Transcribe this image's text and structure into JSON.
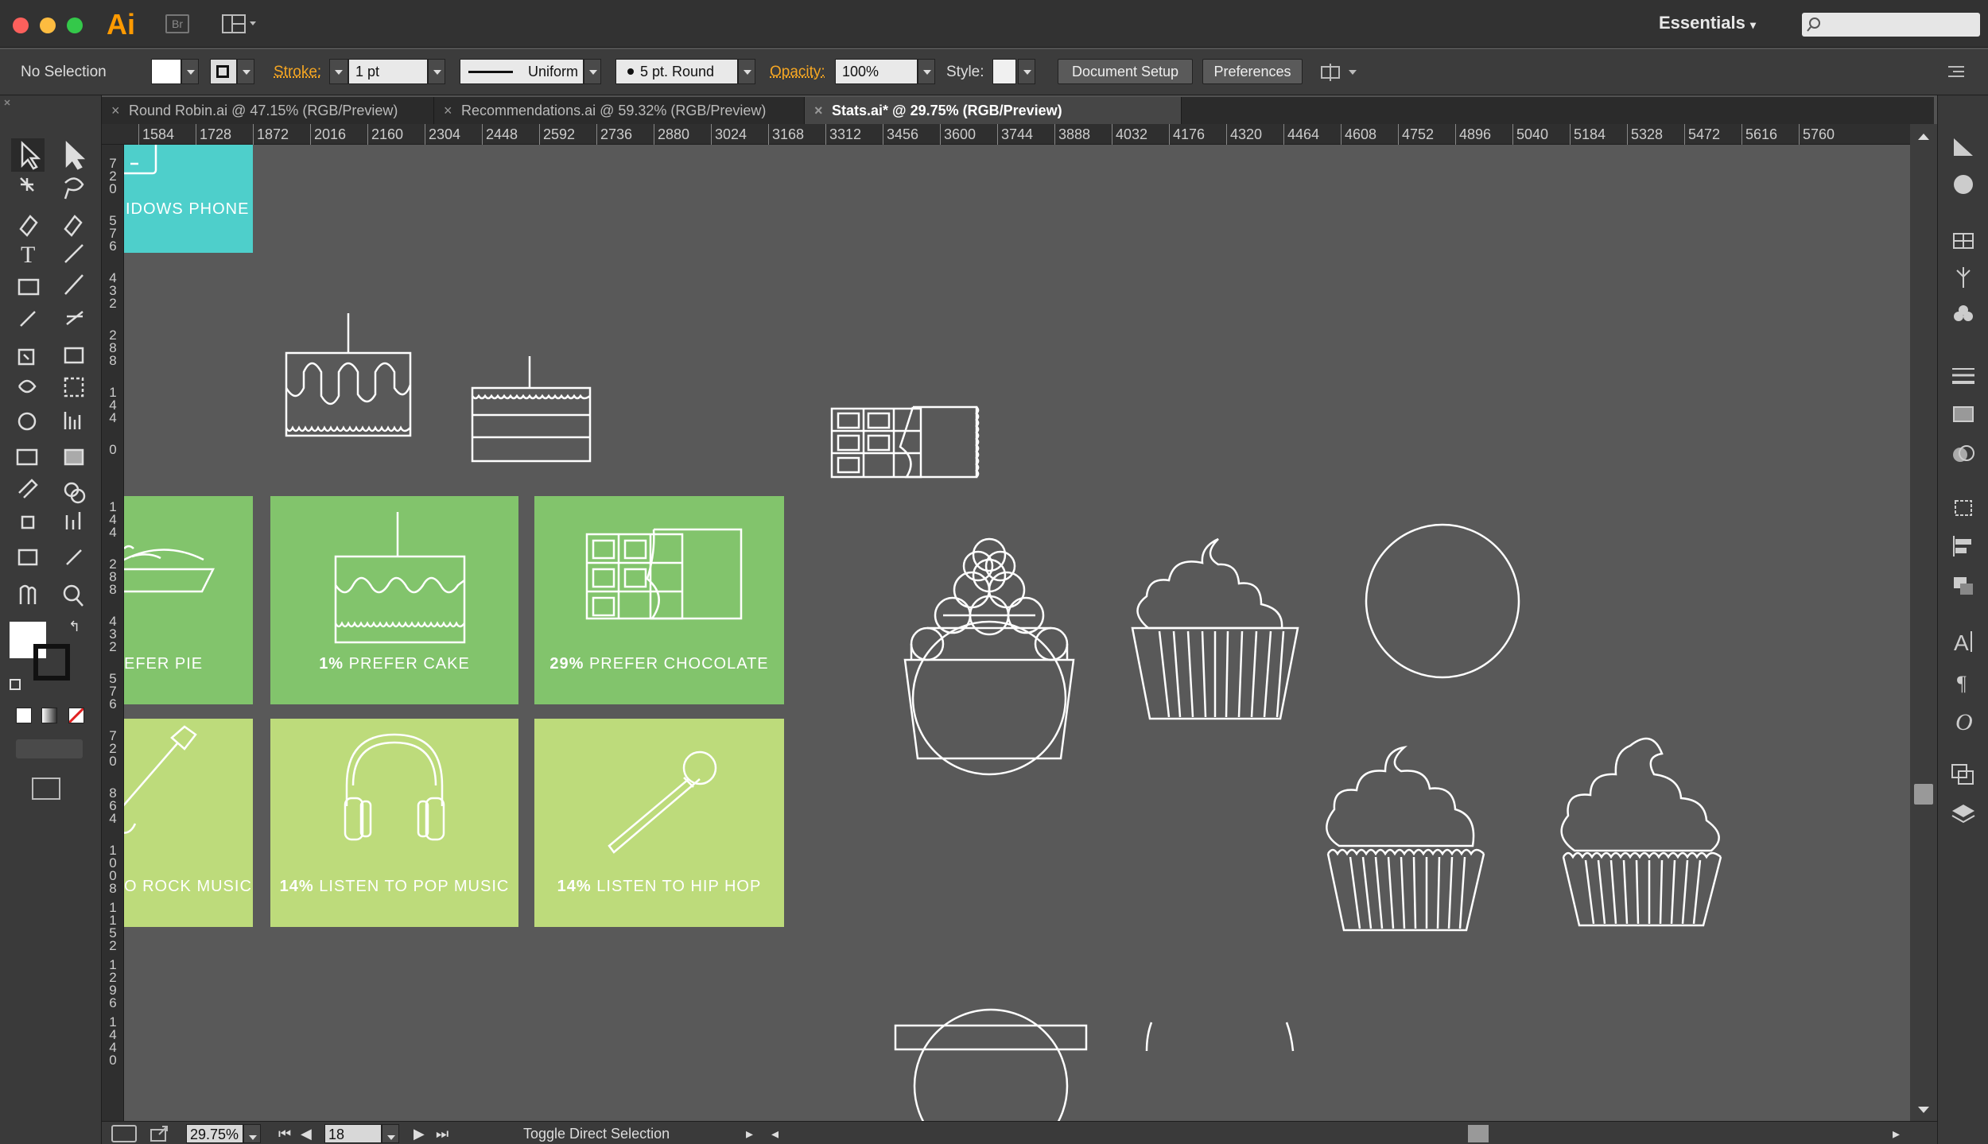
{
  "app": {
    "logo": "Ai",
    "bridge_logo": "Br",
    "workspace": "Essentials"
  },
  "control": {
    "selection": "No Selection",
    "stroke_label": "Stroke:",
    "stroke_weight": "1 pt",
    "profile": "Uniform",
    "brush": "5 pt. Round",
    "opacity_label": "Opacity:",
    "opacity_value": "100%",
    "style_label": "Style:",
    "document_setup": "Document Setup",
    "preferences": "Preferences"
  },
  "tabs": [
    {
      "label": "Round Robin.ai @ 47.15% (RGB/Preview)"
    },
    {
      "label": "Recommendations.ai @ 59.32% (RGB/Preview)"
    },
    {
      "label": "Stats.ai* @ 29.75% (RGB/Preview)",
      "active": true
    }
  ],
  "ruler": {
    "h_ticks": [
      "1584",
      "1728",
      "1872",
      "2016",
      "2160",
      "2304",
      "2448",
      "2592",
      "2736",
      "2880",
      "3024",
      "3168",
      "3312",
      "3456",
      "3600",
      "3744",
      "3888",
      "4032",
      "4176",
      "4320",
      "4464",
      "4608",
      "4752",
      "4896",
      "5040",
      "5184",
      "5328",
      "5472",
      "5616",
      "5760"
    ],
    "v_ticks": [
      "7\n2\n0",
      "5\n7\n6",
      "4\n3\n2",
      "2\n8\n8",
      "1\n4\n4",
      "0",
      "1\n4\n4",
      "2\n8\n8",
      "4\n3\n2",
      "5\n7\n6",
      "7\n2\n0",
      "8\n6\n4",
      "1\n0\n0\n8",
      "1\n1\n5\n2",
      "1\n2\n9\n6",
      "1\n4\n4\n0"
    ]
  },
  "tiles": {
    "windows_phone": {
      "text": "IDOWS PHONE",
      "color": "#4ecfcb"
    },
    "pie": {
      "text": "EFER PIE"
    },
    "cake": {
      "pct": "1%",
      "text": " PREFER CAKE"
    },
    "chocolate": {
      "pct": "29%",
      "text": " PREFER CHOCOLATE"
    },
    "rock": {
      "text": "O ROCK MUSIC"
    },
    "pop": {
      "pct": "14%",
      "text": " LISTEN TO POP MUSIC"
    },
    "hiphop": {
      "pct": "14%",
      "text": " LISTEN TO HIP HOP"
    },
    "green_dark": "#82c46c",
    "green_light": "#bddb7b"
  },
  "status": {
    "zoom": "29.75%",
    "artboard": "18",
    "tool_hint": "Toggle Direct Selection"
  }
}
